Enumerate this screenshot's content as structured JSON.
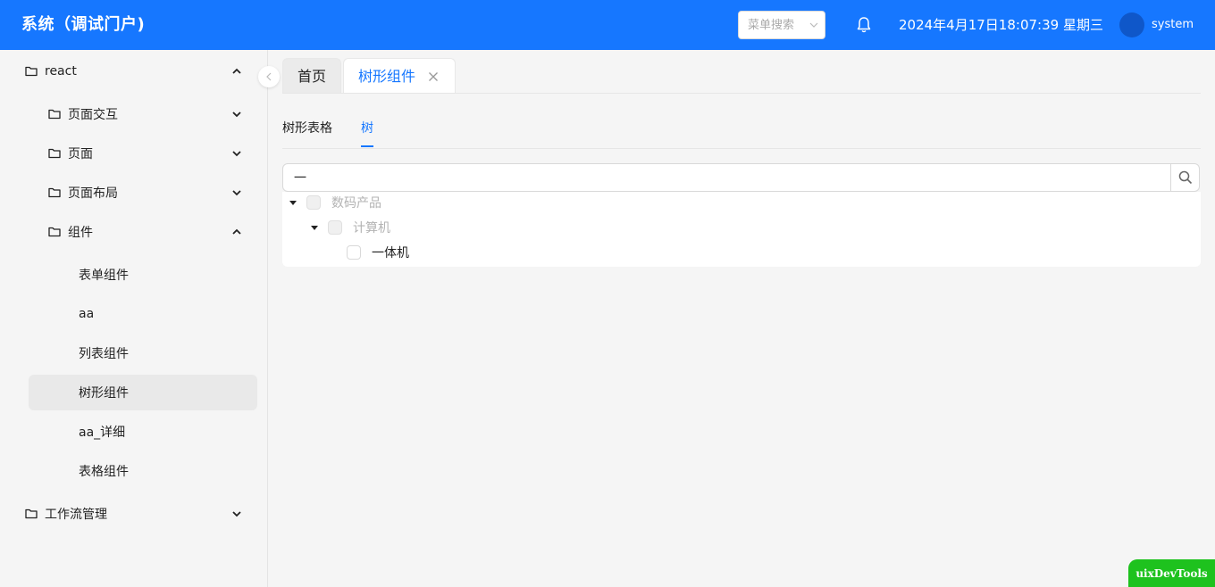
{
  "header": {
    "title": "系统（调试门户)",
    "menu_search_placeholder": "菜单搜索",
    "datetime": "2024年4月17日18:07:39 星期三",
    "username": "system",
    "accent": "#1677ff"
  },
  "sidebar": {
    "items": [
      {
        "label": "react",
        "icon": "folder-icon",
        "expanded": true
      },
      {
        "label": "页面交互",
        "icon": "folder-icon",
        "expanded": false
      },
      {
        "label": "页面",
        "icon": "folder-icon",
        "expanded": false
      },
      {
        "label": "页面布局",
        "icon": "folder-icon",
        "expanded": false
      },
      {
        "label": "组件",
        "icon": "folder-icon",
        "expanded": true
      },
      {
        "label": "表单组件"
      },
      {
        "label": "aa"
      },
      {
        "label": "列表组件"
      },
      {
        "label": "树形组件",
        "selected": true
      },
      {
        "label": "aa_详细"
      },
      {
        "label": "表格组件"
      },
      {
        "label": "工作流管理",
        "icon": "folder-icon",
        "expanded": false
      }
    ]
  },
  "page_tabs": [
    {
      "label": "首页"
    },
    {
      "label": "树形组件",
      "active": true,
      "closable": true
    }
  ],
  "inner_tabs": [
    {
      "label": "树形表格"
    },
    {
      "label": "树",
      "active": true
    }
  ],
  "search": {
    "value": "一"
  },
  "tree": [
    {
      "label": "数码产品",
      "disabled": true,
      "expanded": true,
      "checked": false
    },
    {
      "label": "计算机",
      "disabled": true,
      "expanded": true,
      "checked": false
    },
    {
      "label": "一体机",
      "disabled": false,
      "checked": false
    }
  ],
  "devtools_label": "uixDevTools"
}
